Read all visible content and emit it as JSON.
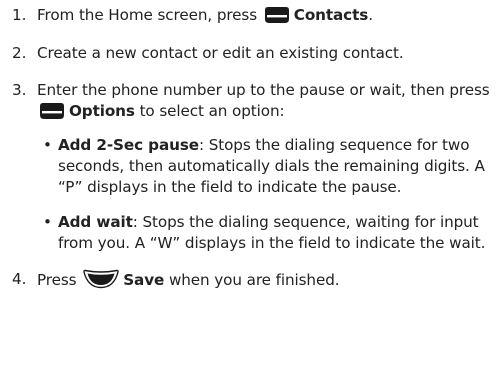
{
  "steps": [
    {
      "num": "1.",
      "text_before": "From the Home screen, press",
      "key_icon": "left-softkey-icon",
      "key_label": "Contacts",
      "text_after": "."
    },
    {
      "num": "2.",
      "text": "Create a new contact or edit an existing contact."
    },
    {
      "num": "3.",
      "text_before": "Enter the phone number up to the pause or wait, then press",
      "key_icon": "left-softkey-icon",
      "key_label": "Options",
      "text_after": " to select an option:",
      "bullets": [
        {
          "label": "Add 2-Sec pause",
          "text": ": Stops the dialing sequence for two seconds, then automatically dials the remaining digits. A “P” displays in the field to indicate the pause."
        },
        {
          "label": "Add wait",
          "text": ": Stops the dialing sequence, waiting for input from you. A “W” displays in the field to indicate the wait."
        }
      ]
    },
    {
      "num": "4.",
      "text_before": "Press",
      "key_icon": "center-select-key-icon",
      "key_label": "Save",
      "text_after": " when you are finished."
    }
  ],
  "colors": {
    "text": "#222222",
    "key_icon": "#1a1a1a"
  }
}
